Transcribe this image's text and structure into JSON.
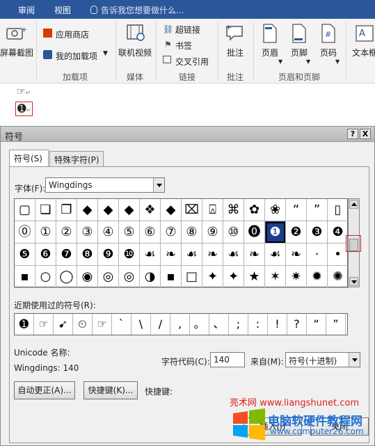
{
  "ribbon_tabs": [
    "审阅",
    "视图"
  ],
  "tell_me": "告诉我您想要做什么...",
  "ribbon": {
    "screenshot_label": "屏幕截图",
    "app_store": "应用商店",
    "my_addins": "我的加载项",
    "addins_group": "加载项",
    "online_video": "联机视频",
    "media_group": "媒体",
    "hyperlink": "超链接",
    "bookmark": "书签",
    "cross_ref": "交叉引用",
    "links_group": "链接",
    "comment": "批注",
    "comment_group": "批注",
    "header": "页眉",
    "footer": "页脚",
    "page_number": "页码",
    "hf_group": "页眉和页脚",
    "textbox": "文本框"
  },
  "document": {
    "line1": "☞",
    "line2": "➊",
    "para_mark": "↵"
  },
  "dialog": {
    "title": "符号",
    "help_btn": "?",
    "close_btn": "X",
    "tabs": [
      "符号(S)",
      "特殊字符(P)"
    ],
    "font_label": "字体(F):",
    "font_value": "Wingdings",
    "symbols": [
      [
        "▢",
        "❏",
        "❐",
        "◆",
        "◆",
        "◆",
        "❖",
        "◆",
        "⌧",
        "⍓",
        "⌘",
        "✿",
        "❀",
        "“",
        "”",
        "▯"
      ],
      [
        "⓪",
        "①",
        "②",
        "③",
        "④",
        "⑤",
        "⑥",
        "⑦",
        "⑧",
        "⑨",
        "⑩",
        "⓿",
        "❶",
        "❷",
        "❸",
        "❹"
      ],
      [
        "❺",
        "❻",
        "❼",
        "❽",
        "❾",
        "❿",
        "☙",
        "❧",
        "☙",
        "❧",
        "☙",
        "❧",
        "☙",
        "❧",
        "·",
        "•"
      ],
      [
        "▪",
        "○",
        "◯",
        "◉",
        "◎",
        "◎",
        "◑",
        "▪",
        "□",
        "✦",
        "✦",
        "★",
        "✶",
        "✷",
        "✹",
        "✺"
      ]
    ],
    "selected_symbol": "➊",
    "recent_label": "近期使用过的符号(R):",
    "recent": [
      "➊",
      "☞",
      "➹",
      "⏲",
      "☞",
      "`",
      "\\",
      "/",
      ",",
      "。",
      "、",
      ";",
      ":",
      "!",
      "?",
      "“",
      "”"
    ],
    "unicode_name_label": "Unicode 名称:",
    "unicode_name_value": "Wingdings: 140",
    "char_code_label": "字符代码(C):",
    "char_code_value": "140",
    "from_label": "来自(M):",
    "from_value": "符号(十进制)",
    "autocorrect_btn": "自动更正(A)...",
    "shortcut_btn": "快捷键(K)...",
    "shortcut_label": "快捷键:",
    "insert_btn": "插入(I)",
    "close_dialog_btn": "关闭"
  },
  "watermark": {
    "line1": "亮术网 www.liangshunet.com",
    "line2": "电脑软硬件教程网",
    "line3": "www.computer26.com"
  }
}
